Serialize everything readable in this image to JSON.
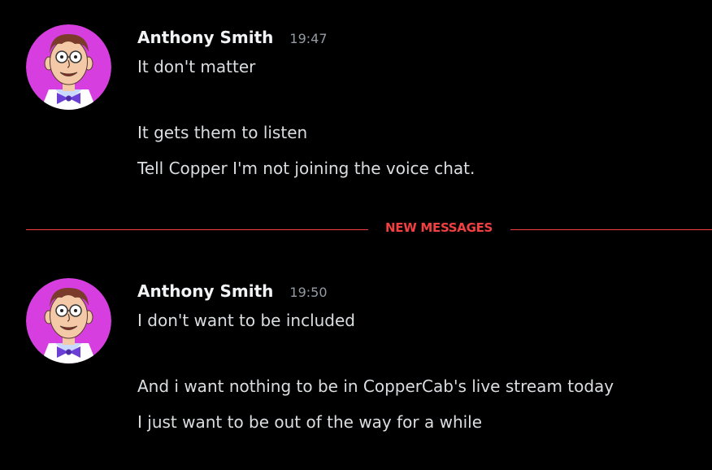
{
  "messages": [
    {
      "author": "Anthony Smith",
      "time": "19:47",
      "lines": [
        "It don't matter",
        "It gets them to listen",
        "Tell Copper I'm not joining the voice chat."
      ]
    },
    {
      "author": "Anthony Smith",
      "time": "19:50",
      "lines": [
        "I don't want to be included",
        "And i want nothing to be in CopperCab's live stream today",
        "I just want to be out of the way for a while"
      ]
    }
  ],
  "divider": {
    "label": "NEW MESSAGES",
    "color": "#f23f42"
  },
  "colors": {
    "background": "#000000",
    "avatar_bg": "#d63ee0",
    "username": "#f2f3f5",
    "message_text": "#dbdee1",
    "timestamp": "#949ba4"
  },
  "icons": {
    "avatar": "cartoon-man-glasses-bowtie-avatar"
  }
}
